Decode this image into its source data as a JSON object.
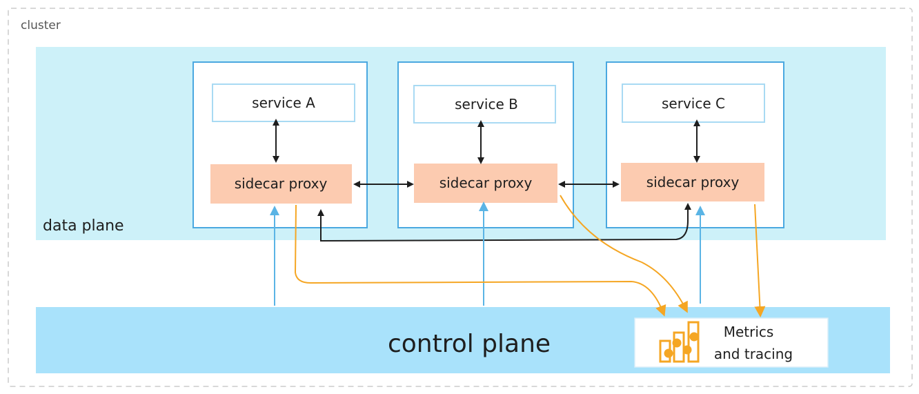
{
  "cluster": {
    "label": "cluster"
  },
  "data_plane": {
    "label": "data plane"
  },
  "control_plane": {
    "label": "control plane"
  },
  "services": [
    {
      "name": "service A",
      "proxy": "sidecar proxy"
    },
    {
      "name": "service B",
      "proxy": "sidecar proxy"
    },
    {
      "name": "service C",
      "proxy": "sidecar proxy"
    }
  ],
  "metrics": {
    "line1": "Metrics",
    "line2": "and tracing",
    "icon": "bar-chart-icon"
  },
  "colors": {
    "data_plane": "#cdf1f9",
    "control_plane": "#a9e2fb",
    "box_border": "#4aa8e0",
    "proxy_fill": "#fccbb0",
    "orange": "#f5a623",
    "blue_arrow": "#5ab4e5",
    "dark_arrow": "#1e1e1e"
  }
}
